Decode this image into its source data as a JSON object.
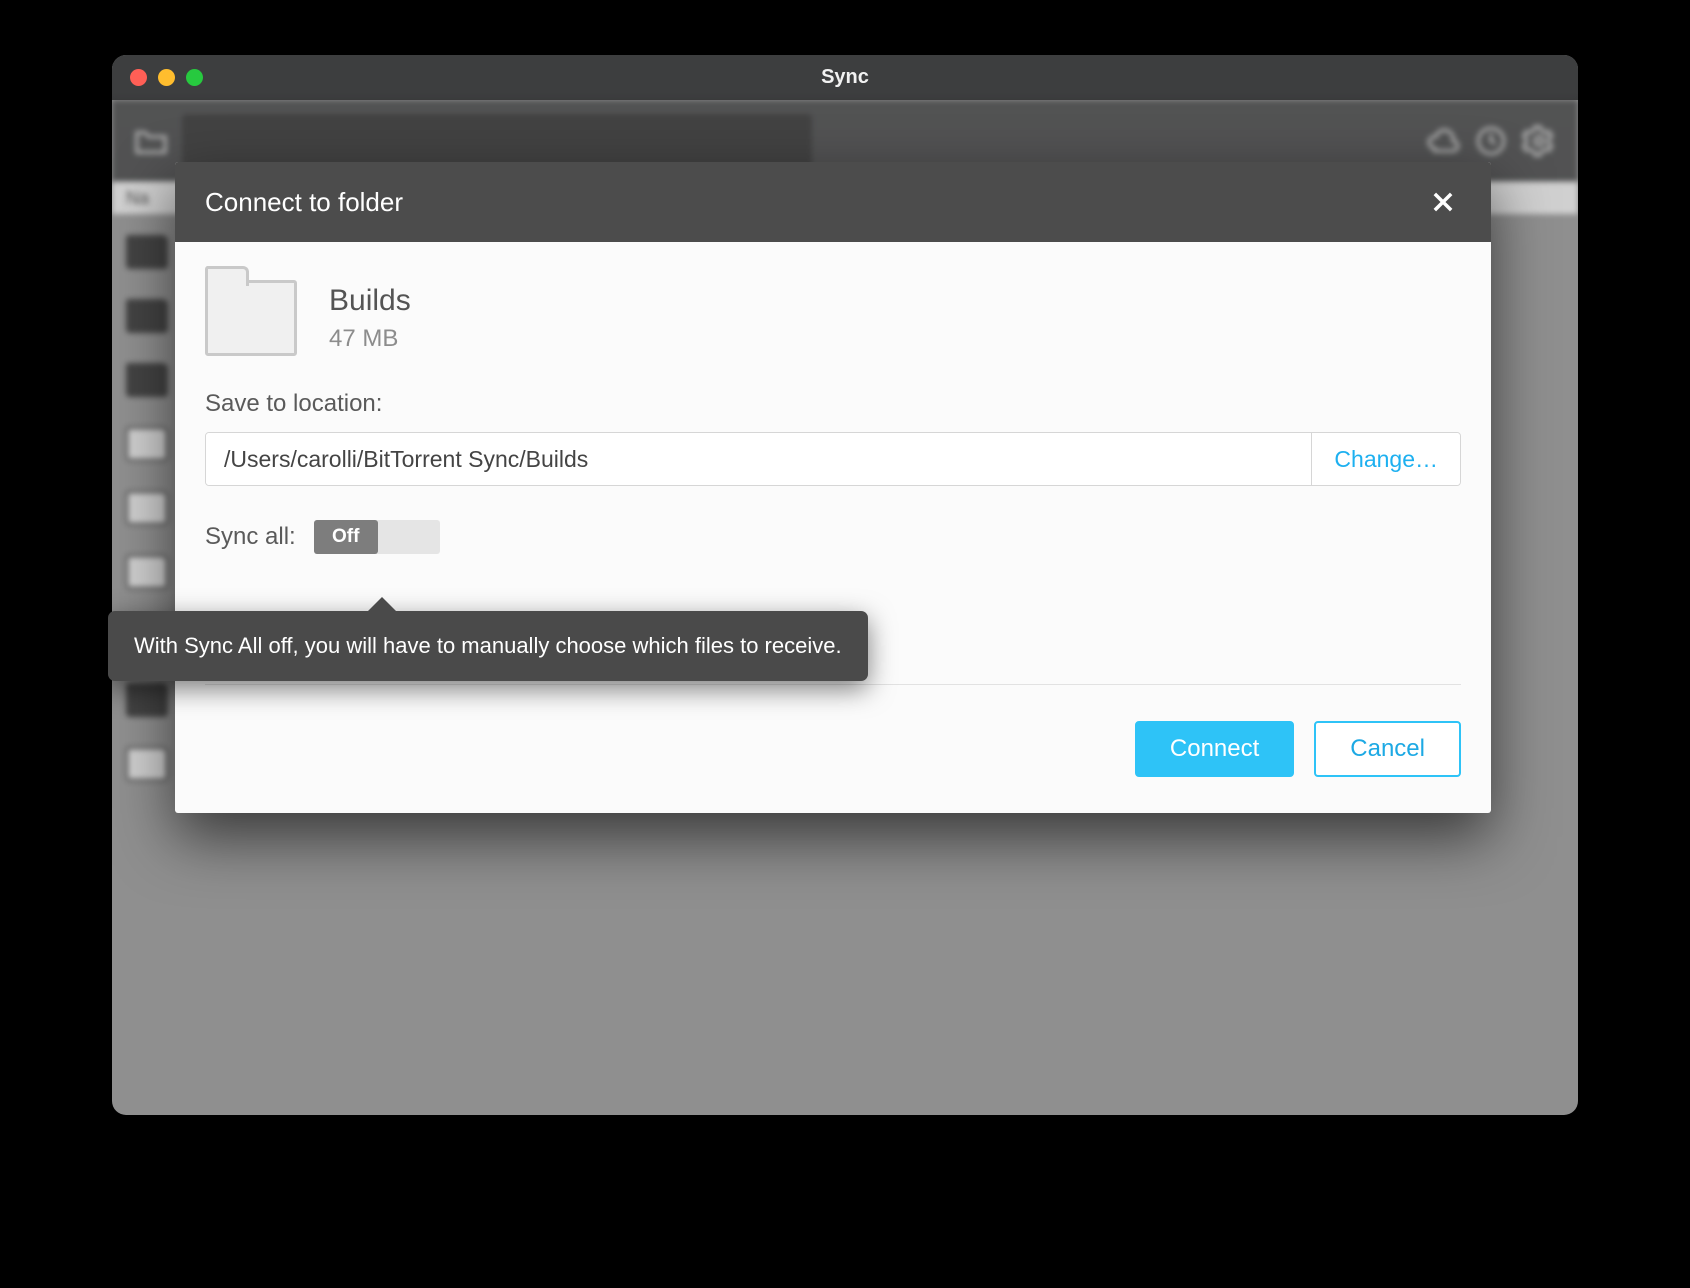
{
  "window": {
    "title": "Sync",
    "table_header": "Na"
  },
  "dialog": {
    "title": "Connect to folder",
    "folder_name": "Builds",
    "folder_size": "47 MB",
    "save_label": "Save to location:",
    "path": "/Users/carolli/BitTorrent Sync/Builds",
    "change_label": "Change…",
    "syncall_label": "Sync all:",
    "toggle_state": "Off",
    "connect_label": "Connect",
    "cancel_label": "Cancel"
  },
  "tooltip": {
    "text": "With Sync All off, you will have to manually choose which files to receive."
  }
}
